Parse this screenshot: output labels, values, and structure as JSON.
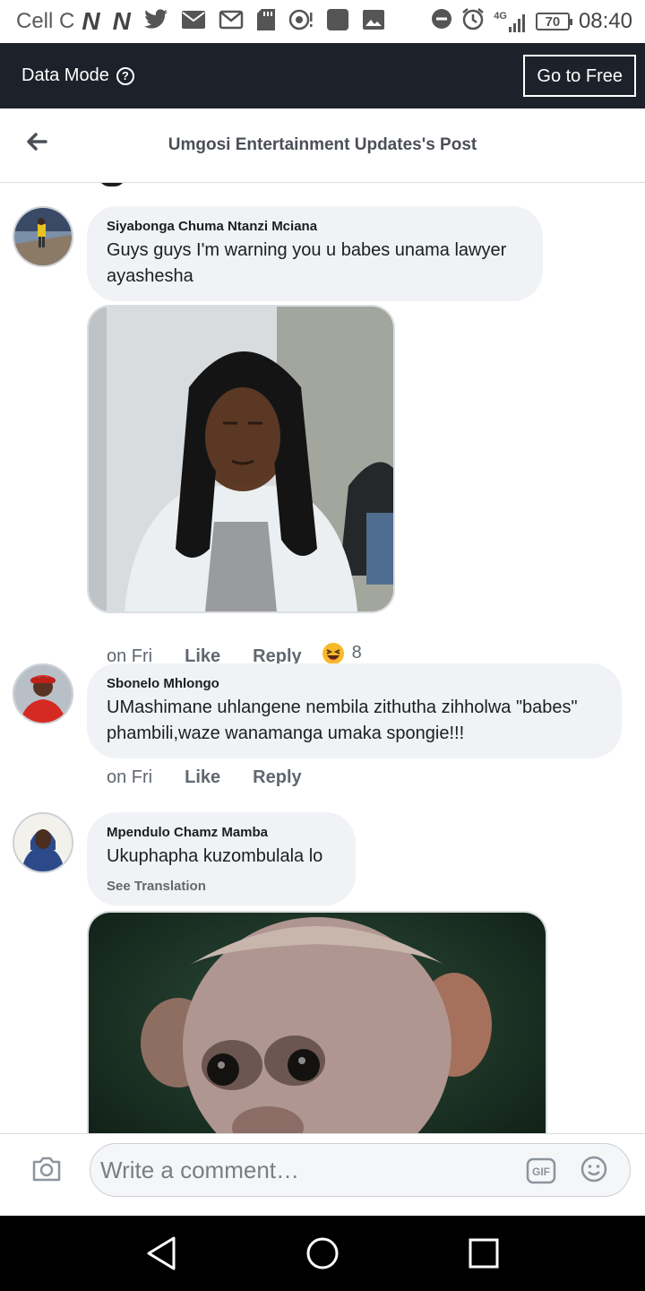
{
  "status_bar": {
    "carrier": "Cell C",
    "network": "4G",
    "battery": "70",
    "time": "08:40"
  },
  "data_mode": {
    "label": "Data Mode",
    "button": "Go to Free"
  },
  "header": {
    "title": "Umgosi Entertainment Updates's Post"
  },
  "comments": [
    {
      "author": "Siyabonga Chuma Ntanzi Mciana",
      "text": "Guys guys I'm warning you u babes unama lawyer ayashesha",
      "time": "on Fri",
      "like": "Like",
      "reply": "Reply",
      "reaction_count": "8"
    },
    {
      "author": "Sbonelo Mhlongo",
      "text": "UMashimane uhlangene nembila zithutha zihholwa \"babes\" phambili,waze wanamanga umaka spongie!!!",
      "time": "on Fri",
      "like": "Like",
      "reply": "Reply"
    },
    {
      "author": "Mpendulo Chamz Mamba",
      "text": "Ukuphapha kuzombulala lo",
      "see_translation": "See Translation"
    }
  ],
  "composer": {
    "placeholder": "Write a comment…",
    "gif_label": "GIF"
  },
  "icons": {
    "back": "arrow-left-icon",
    "camera": "camera-icon",
    "gif": "gif-icon",
    "emoji": "smiley-icon",
    "nav_back": "triangle-back-icon",
    "nav_home": "circle-home-icon",
    "nav_recents": "square-recents-icon"
  },
  "colors": {
    "data_mode_bar": "#1d2129",
    "bubble": "#f0f2f5",
    "nav_bar": "#000000"
  }
}
